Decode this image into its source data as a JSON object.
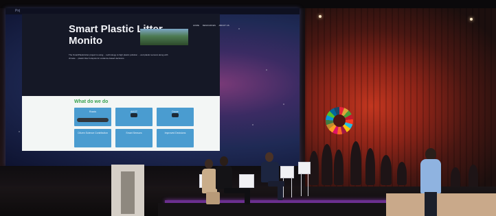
{
  "scene": "conference stage with panel discussion in front of a projected website",
  "projection": {
    "browser_tab": "Pn|",
    "hero_title": "Smart Plastic Litter Monito",
    "hero_text": "The SmartPlasticLitter project is using ... technology to high plastic pollution ... and plastic sensors along with climate ... plastic litter hotspots for evidence-based decisions.",
    "nav_items": [
      "HOME",
      "RESOURCES",
      "ABOUT US"
    ],
    "section_title": "What do we do",
    "cards": [
      "Roads",
      "AI/IOT",
      "Drone",
      "Citizen Science Contribution",
      "Smart Sensors",
      "Improved Decisions"
    ]
  },
  "colors": {
    "screen_bg": "#1f2a55",
    "accent_green": "#37a150",
    "card_blue": "#4a9cd0",
    "wall_red": "#8e2418",
    "stage_glow": "#8a3bb5"
  },
  "icons": [
    "sdg-wheel-icon",
    "drone-icon",
    "camera-icon",
    "road-icon"
  ]
}
